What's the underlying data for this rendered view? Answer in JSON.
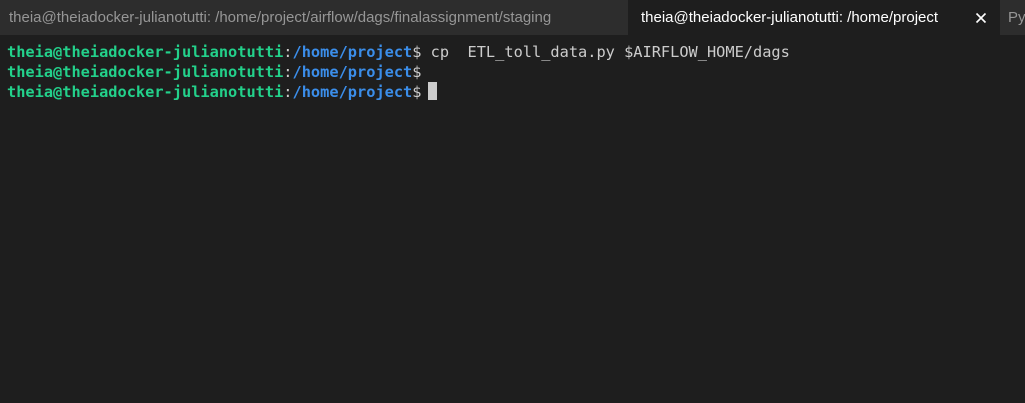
{
  "tabs": [
    {
      "label": "theia@theiadocker-julianotutti: /home/project/airflow/dags/finalassignment/staging",
      "active": false
    },
    {
      "label": "theia@theiadocker-julianotutti: /home/project",
      "active": true
    },
    {
      "label": "Py",
      "active": false
    }
  ],
  "close_icon": "close-icon",
  "terminal": {
    "lines": [
      {
        "user": "theia@theiadocker-julianotutti",
        "colon": ":",
        "path": "/home/project",
        "dollar": "$",
        "command": " cp  ETL_toll_data.py $AIRFLOW_HOME/dags"
      },
      {
        "user": "theia@theiadocker-julianotutti",
        "colon": ":",
        "path": "/home/project",
        "dollar": "$",
        "command": ""
      },
      {
        "user": "theia@theiadocker-julianotutti",
        "colon": ":",
        "path": "/home/project",
        "dollar": "$",
        "command": ""
      }
    ]
  },
  "colors": {
    "background": "#1e1e1e",
    "user": "#23d18b",
    "path": "#3b8eea",
    "text": "#cccccc"
  }
}
